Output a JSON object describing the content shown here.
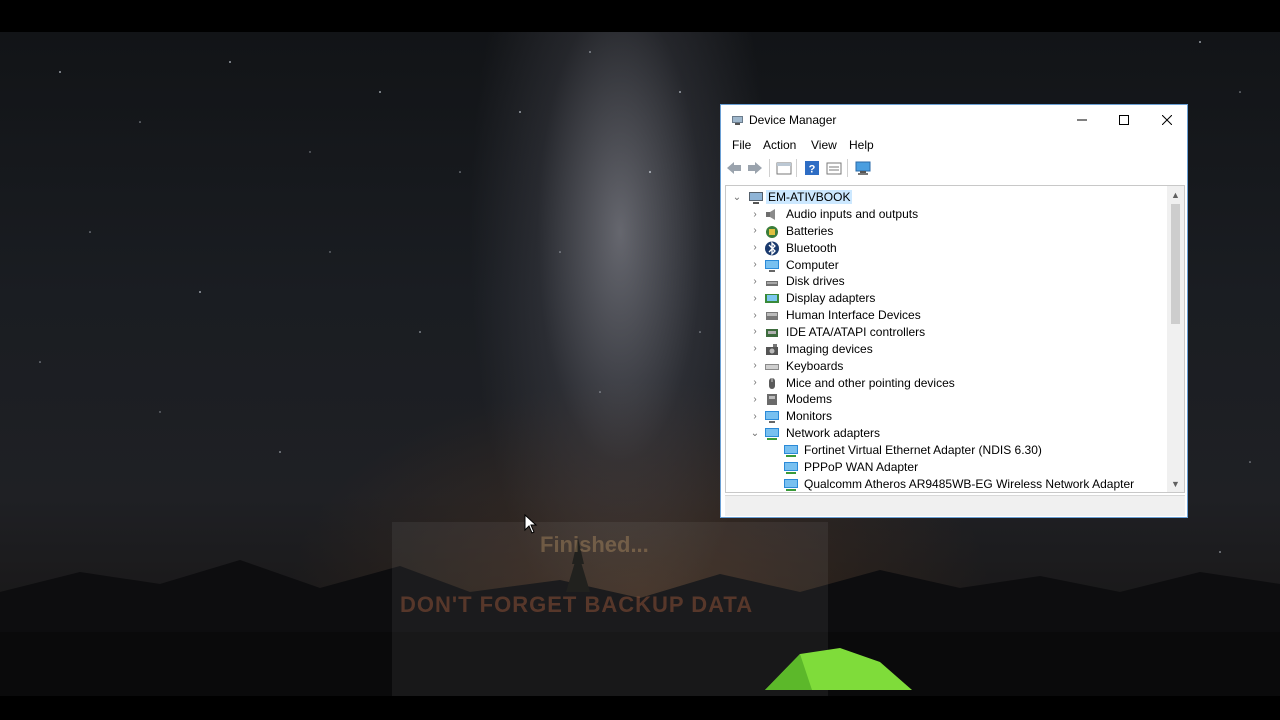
{
  "desktop": {
    "overlay_finished": "Finished...",
    "overlay_backup": "DON'T FORGET BACKUP DATA"
  },
  "window": {
    "title": "Device Manager",
    "minimize_icon": "minimize-icon",
    "maximize_icon": "maximize-icon",
    "close_icon": "close-icon"
  },
  "menu": {
    "file": "File",
    "action": "Action",
    "view": "View",
    "help": "Help"
  },
  "toolbar": {
    "icons": [
      "back-arrow-icon",
      "forward-arrow-icon",
      "properties-icon",
      "help-icon",
      "show-hidden-icon",
      "scan-hardware-icon"
    ]
  },
  "tree": {
    "root": "EM-ATIVBOOK",
    "categories": [
      {
        "label": "Audio inputs and outputs",
        "icon": "speaker-icon"
      },
      {
        "label": "Batteries",
        "icon": "battery-icon"
      },
      {
        "label": "Bluetooth",
        "icon": "bluetooth-icon"
      },
      {
        "label": "Computer",
        "icon": "monitor-icon"
      },
      {
        "label": "Disk drives",
        "icon": "disk-drive-icon"
      },
      {
        "label": "Display adapters",
        "icon": "display-adapter-icon"
      },
      {
        "label": "Human Interface Devices",
        "icon": "hid-icon"
      },
      {
        "label": "IDE ATA/ATAPI controllers",
        "icon": "ide-controller-icon"
      },
      {
        "label": "Imaging devices",
        "icon": "camera-icon"
      },
      {
        "label": "Keyboards",
        "icon": "keyboard-icon"
      },
      {
        "label": "Mice and other pointing devices",
        "icon": "mouse-icon"
      },
      {
        "label": "Modems",
        "icon": "modem-icon"
      },
      {
        "label": "Monitors",
        "icon": "monitor-icon"
      },
      {
        "label": "Network adapters",
        "icon": "network-adapter-icon"
      }
    ],
    "network_children": [
      "Fortinet Virtual Ethernet Adapter (NDIS 6.30)",
      "PPPoP WAN Adapter",
      "Qualcomm Atheros AR9485WB-EG Wireless Network Adapter"
    ]
  }
}
